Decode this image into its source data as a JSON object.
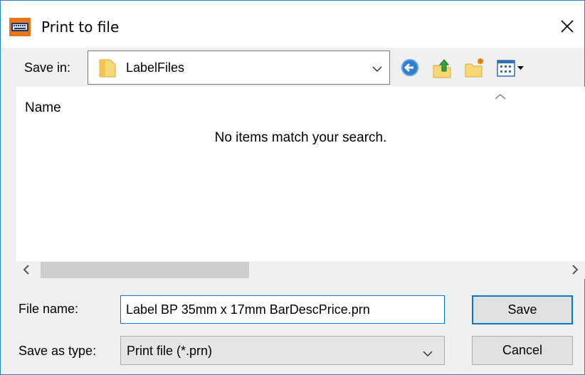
{
  "window": {
    "title": "Print to file"
  },
  "toolbar": {
    "save_in_label": "Save in:",
    "location": "LabelFiles"
  },
  "file_list": {
    "column_name": "Name",
    "empty_message": "No items match your search."
  },
  "footer": {
    "file_name_label": "File name:",
    "file_name_value": "Label BP 35mm x 17mm BarDescPrice.prn",
    "save_as_type_label": "Save as type:",
    "save_as_type_value": "Print file (*.prn)",
    "save_button": "Save",
    "cancel_button": "Cancel"
  },
  "icons": {
    "app": "printer-icon",
    "close": "close-icon",
    "folder": "folder-icon",
    "back": "back-arrow-icon",
    "up": "up-folder-icon",
    "new_folder": "new-folder-icon",
    "view_menu": "view-menu-icon"
  },
  "colors": {
    "accent": "#0078d7",
    "window_border": "#2b7fd6",
    "dialog_bg": "#f0f0f0"
  }
}
